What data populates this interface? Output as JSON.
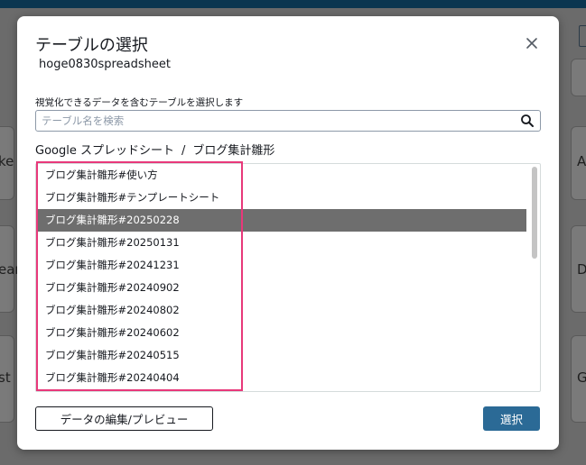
{
  "background": {
    "left_cards": [
      "ke",
      "ear",
      "st"
    ],
    "right_cards": [
      "A",
      "D",
      "G"
    ]
  },
  "dialog": {
    "title": "テーブルの選択",
    "subtitle": "hoge0830spreadsheet",
    "close_icon": "close-icon",
    "search": {
      "label": "視覚化できるデータを含むテーブルを選択します",
      "placeholder": "テーブル名を検索",
      "value": "",
      "icon": "search-icon"
    },
    "breadcrumb": {
      "root": "Google スプレッドシート",
      "separator": "/",
      "current": "ブログ集計雛形"
    },
    "tables": [
      {
        "label": "ブログ集計雛形#使い方",
        "selected": false
      },
      {
        "label": "ブログ集計雛形#テンプレートシート",
        "selected": false
      },
      {
        "label": "ブログ集計雛形#20250228",
        "selected": true
      },
      {
        "label": "ブログ集計雛形#20250131",
        "selected": false
      },
      {
        "label": "ブログ集計雛形#20241231",
        "selected": false
      },
      {
        "label": "ブログ集計雛形#20240902",
        "selected": false
      },
      {
        "label": "ブログ集計雛形#20240802",
        "selected": false
      },
      {
        "label": "ブログ集計雛形#20240602",
        "selected": false
      },
      {
        "label": "ブログ集計雛形#20240515",
        "selected": false
      },
      {
        "label": "ブログ集計雛形#20240404",
        "selected": false
      }
    ],
    "buttons": {
      "edit_preview": "データの編集/プレビュー",
      "select": "選択"
    }
  },
  "colors": {
    "primary_button": "#2b6a96",
    "selected_row": "#6e6e6e",
    "highlight_border": "#e8387a",
    "top_bar": "#0b3650"
  }
}
